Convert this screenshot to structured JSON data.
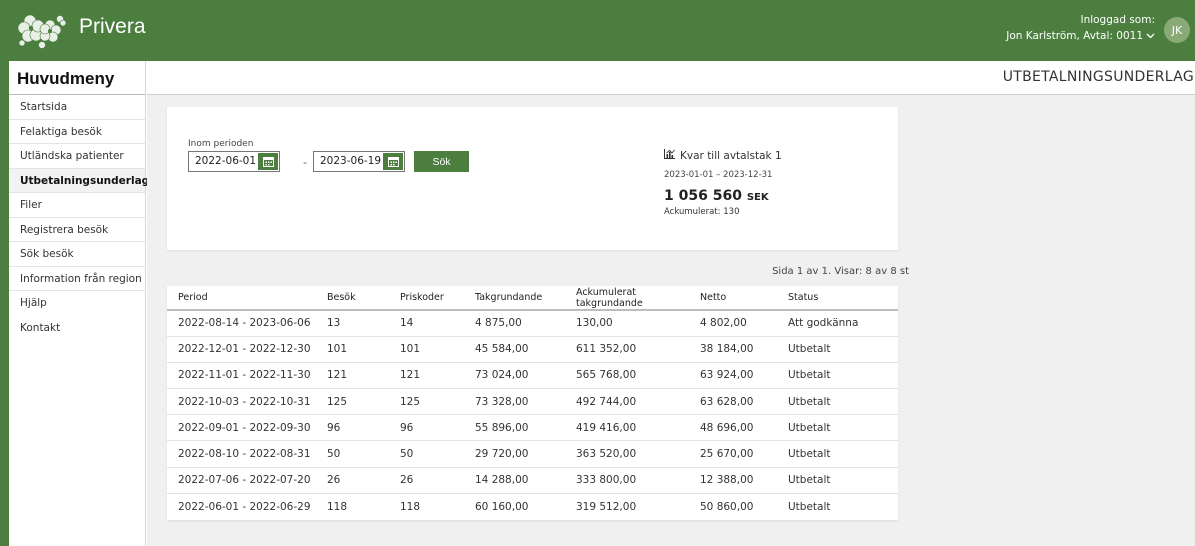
{
  "brand": {
    "name": "Privera"
  },
  "user": {
    "logged_in_label": "Inloggad som:",
    "account": "Jon Karlström, Avtal: 0011",
    "initials": "JK"
  },
  "sidebar": {
    "title": "Huvudmeny",
    "items": [
      {
        "label": "Startsida"
      },
      {
        "label": "Felaktiga besök"
      },
      {
        "label": "Utländska patienter"
      },
      {
        "label": "Utbetalningsunderlag",
        "active": true
      },
      {
        "label": "Filer"
      },
      {
        "label": "Registrera besök"
      },
      {
        "label": "Sök besök"
      },
      {
        "label": "Information från region"
      },
      {
        "label": "Hjälp"
      },
      {
        "label": "Kontakt"
      }
    ]
  },
  "page": {
    "title": "UTBETALNINGSUNDERLAG"
  },
  "filter": {
    "period_label": "Inom perioden",
    "date_from": "2022-06-01",
    "separator": "-",
    "date_to": "2023-06-19",
    "search_label": "Sök"
  },
  "cap": {
    "title": "Kvar till avtalstak 1",
    "range": "2023-01-01 – 2023-12-31",
    "amount": "1 056 560",
    "currency": "SEK",
    "accumulated": "Ackumulerat: 130"
  },
  "pagination": {
    "text": "Sida 1 av 1. Visar: 8 av 8 st"
  },
  "table": {
    "columns": [
      "Period",
      "Besök",
      "Priskoder",
      "Takgrundande",
      "Ackumulerat takgrundande",
      "Netto",
      "Status"
    ],
    "rows": [
      [
        "2022-08-14 - 2023-06-06",
        "13",
        "14",
        "4 875,00",
        "130,00",
        "4 802,00",
        "Att godkänna"
      ],
      [
        "2022-12-01 - 2022-12-30",
        "101",
        "101",
        "45 584,00",
        "611 352,00",
        "38 184,00",
        "Utbetalt"
      ],
      [
        "2022-11-01 - 2022-11-30",
        "121",
        "121",
        "73 024,00",
        "565 768,00",
        "63 924,00",
        "Utbetalt"
      ],
      [
        "2022-10-03 - 2022-10-31",
        "125",
        "125",
        "73 328,00",
        "492 744,00",
        "63 628,00",
        "Utbetalt"
      ],
      [
        "2022-09-01 - 2022-09-30",
        "96",
        "96",
        "55 896,00",
        "419 416,00",
        "48 696,00",
        "Utbetalt"
      ],
      [
        "2022-08-10 - 2022-08-31",
        "50",
        "50",
        "29 720,00",
        "363 520,00",
        "25 670,00",
        "Utbetalt"
      ],
      [
        "2022-07-06 - 2022-07-20",
        "26",
        "26",
        "14 288,00",
        "333 800,00",
        "12 388,00",
        "Utbetalt"
      ],
      [
        "2022-06-01 - 2022-06-29",
        "118",
        "118",
        "60 160,00",
        "319 512,00",
        "50 860,00",
        "Utbetalt"
      ]
    ]
  },
  "colors": {
    "brand_green": "#4b7e3f",
    "background": "#f0f0f0"
  },
  "icons": {
    "logo": "flower-logo-icon",
    "calendar": "calendar-icon",
    "chart": "chart-icon",
    "chevron": "chevron-down-icon"
  }
}
